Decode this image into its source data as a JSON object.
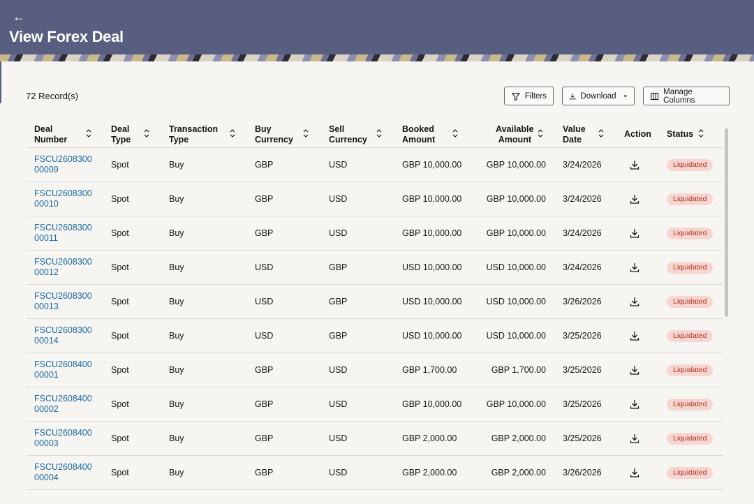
{
  "header": {
    "back_icon": "arrow-left-icon",
    "title": "View Forex Deal"
  },
  "toolbar": {
    "records": "72 Record(s)",
    "filters_label": "Filters",
    "download_label": "Download",
    "manage_label": "Manage Columns"
  },
  "table": {
    "columns": [
      {
        "l1": "Deal",
        "l2": "Number"
      },
      {
        "l1": "Deal",
        "l2": "Type"
      },
      {
        "l1": "Transaction",
        "l2": "Type"
      },
      {
        "l1": "Buy",
        "l2": "Currency"
      },
      {
        "l1": "Sell",
        "l2": "Currency"
      },
      {
        "l1": "Booked",
        "l2": "Amount"
      },
      {
        "l1": "Available",
        "l2": "Amount"
      },
      {
        "l1": "Value",
        "l2": "Date"
      },
      {
        "l1": "Action",
        "l2": ""
      },
      {
        "l1": "Status",
        "l2": ""
      }
    ],
    "rows": [
      {
        "deal_1": "FSCU2608300",
        "deal_2": "00009",
        "type": "Spot",
        "txn": "Buy",
        "buy": "GBP",
        "sell": "USD",
        "booked": "GBP 10,000.00",
        "available": "GBP 10,000.00",
        "date": "3/24/2026",
        "status": "Liquidated"
      },
      {
        "deal_1": "FSCU2608300",
        "deal_2": "00010",
        "type": "Spot",
        "txn": "Buy",
        "buy": "GBP",
        "sell": "USD",
        "booked": "GBP 10,000.00",
        "available": "GBP 10,000.00",
        "date": "3/24/2026",
        "status": "Liquidated"
      },
      {
        "deal_1": "FSCU2608300",
        "deal_2": "00011",
        "type": "Spot",
        "txn": "Buy",
        "buy": "GBP",
        "sell": "USD",
        "booked": "GBP 10,000.00",
        "available": "GBP 10,000.00",
        "date": "3/24/2026",
        "status": "Liquidated"
      },
      {
        "deal_1": "FSCU2608300",
        "deal_2": "00012",
        "type": "Spot",
        "txn": "Buy",
        "buy": "USD",
        "sell": "GBP",
        "booked": "USD 10,000.00",
        "available": "USD 10,000.00",
        "date": "3/24/2026",
        "status": "Liquidated"
      },
      {
        "deal_1": "FSCU2608300",
        "deal_2": "00013",
        "type": "Spot",
        "txn": "Buy",
        "buy": "USD",
        "sell": "GBP",
        "booked": "USD 10,000.00",
        "available": "USD 10,000.00",
        "date": "3/26/2026",
        "status": "Liquidated"
      },
      {
        "deal_1": "FSCU2608300",
        "deal_2": "00014",
        "type": "Spot",
        "txn": "Buy",
        "buy": "USD",
        "sell": "GBP",
        "booked": "USD 10,000.00",
        "available": "USD 10,000.00",
        "date": "3/25/2026",
        "status": "Liquidated"
      },
      {
        "deal_1": "FSCU2608400",
        "deal_2": "00001",
        "type": "Spot",
        "txn": "Buy",
        "buy": "GBP",
        "sell": "USD",
        "booked": "GBP 1,700.00",
        "available": "GBP 1,700.00",
        "date": "3/25/2026",
        "status": "Liquidated"
      },
      {
        "deal_1": "FSCU2608400",
        "deal_2": "00002",
        "type": "Spot",
        "txn": "Buy",
        "buy": "GBP",
        "sell": "USD",
        "booked": "GBP 10,000.00",
        "available": "GBP 10,000.00",
        "date": "3/25/2026",
        "status": "Liquidated"
      },
      {
        "deal_1": "FSCU2608400",
        "deal_2": "00003",
        "type": "Spot",
        "txn": "Buy",
        "buy": "GBP",
        "sell": "USD",
        "booked": "GBP 2,000.00",
        "available": "GBP 2,000.00",
        "date": "3/25/2026",
        "status": "Liquidated"
      },
      {
        "deal_1": "FSCU2608400",
        "deal_2": "00004",
        "type": "Spot",
        "txn": "Buy",
        "buy": "GBP",
        "sell": "USD",
        "booked": "GBP 2,000.00",
        "available": "GBP 2,000.00",
        "date": "3/26/2026",
        "status": "Liquidated"
      }
    ],
    "action_icon": "download-icon"
  },
  "colors": {
    "header_bg": "#585e80",
    "link": "#1b6aa5",
    "badge_bg": "#f7d6d2",
    "badge_text": "#b0331f"
  }
}
